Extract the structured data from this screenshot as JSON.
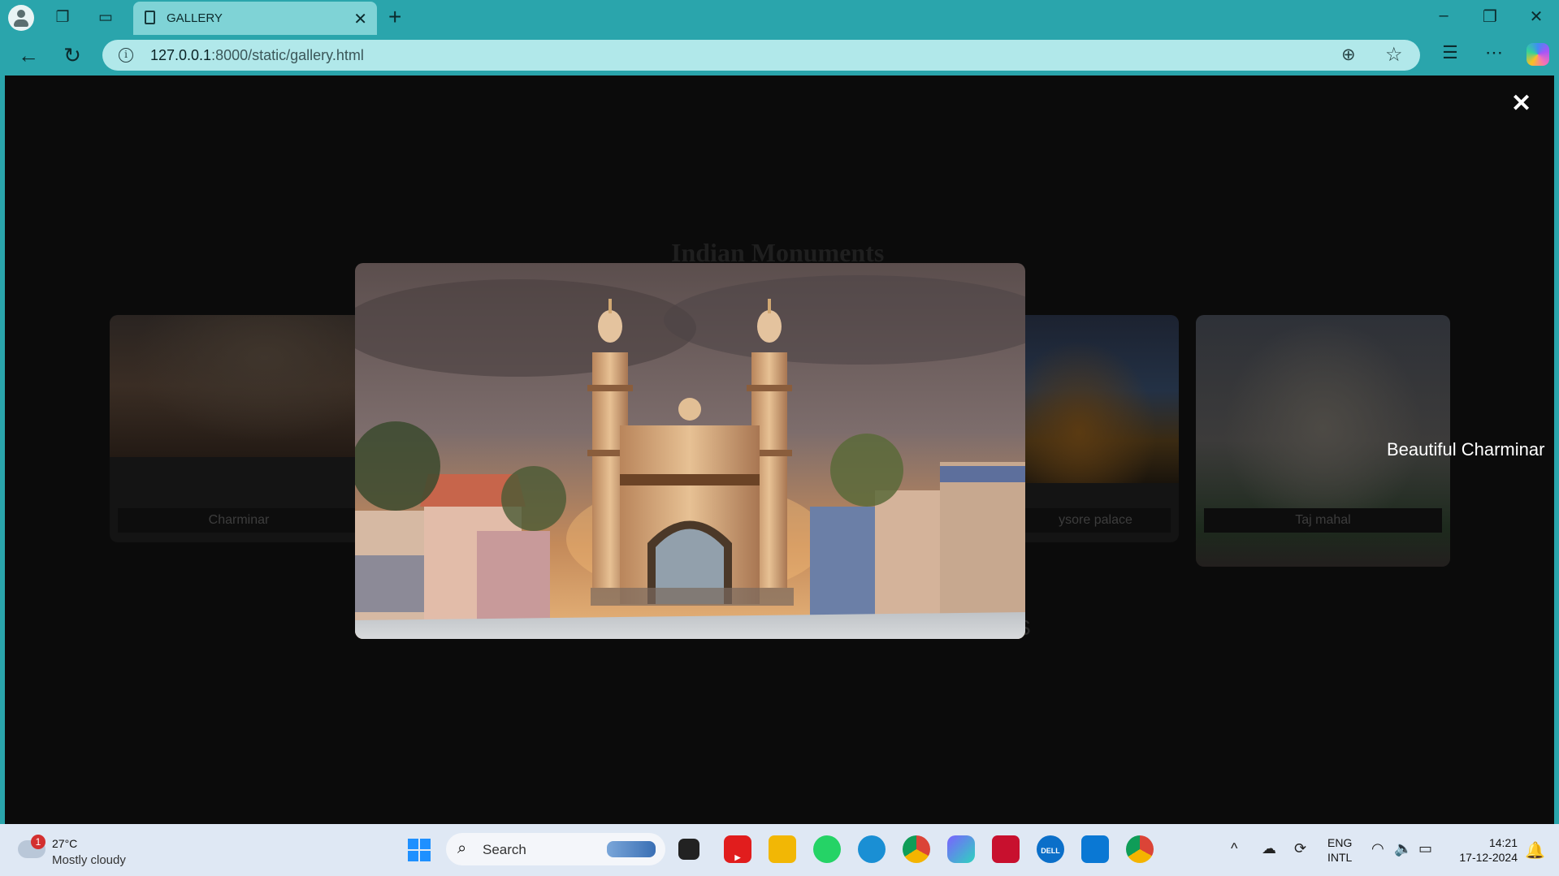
{
  "browser": {
    "tab_title": "GALLERY",
    "url_host": "127.0.0.1",
    "url_path": ":8000/static/gallery.html"
  },
  "page": {
    "heading": "Indian Monuments",
    "cards": [
      {
        "label": "Charminar"
      },
      {
        "label": "ysore palace"
      },
      {
        "label": "Taj mahal"
      }
    ],
    "faint_text": "KS"
  },
  "lightbox": {
    "close_symbol": "✕",
    "caption": "Beautiful Charminar"
  },
  "taskbar": {
    "weather": {
      "badge": "1",
      "temperature": "27°C",
      "condition": "Mostly cloudy"
    },
    "search_placeholder": "Search",
    "apps": [
      "windows-start",
      "task-view",
      "youtube",
      "file-explorer",
      "whatsapp",
      "edge",
      "chrome",
      "copilot",
      "mcafee",
      "dell",
      "vscode",
      "chrome"
    ],
    "language": {
      "line1": "ENG",
      "line2": "INTL"
    },
    "clock": {
      "time": "14:21",
      "date": "17-12-2024"
    }
  },
  "colors": {
    "chrome_bar": "#2aa5ac",
    "active_tab": "#7fd3d6",
    "address_bar": "#b1e8ea",
    "page_background": "#0b0b0b",
    "taskbar": "#dfe8f4"
  }
}
